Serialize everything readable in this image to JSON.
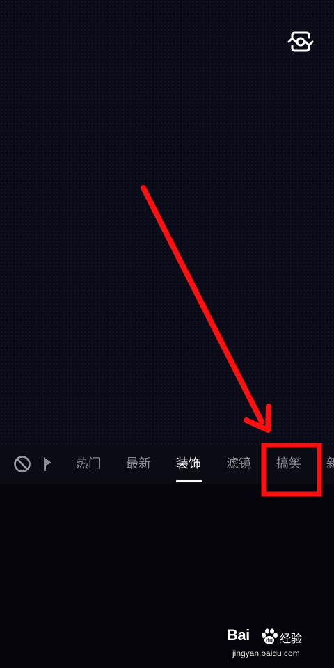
{
  "tabs": [
    {
      "label": "热门",
      "active": false
    },
    {
      "label": "最新",
      "active": false
    },
    {
      "label": "装饰",
      "active": true
    },
    {
      "label": "滤镜",
      "active": false
    },
    {
      "label": "搞笑",
      "active": false
    },
    {
      "label": "新",
      "active": false
    }
  ],
  "icons": {
    "flip_camera": "flip-camera-icon",
    "none": "prohibited-icon",
    "shape": "flag-shape-icon"
  },
  "annotation": {
    "color": "#ff1010",
    "highlighted_tab": "搞笑"
  },
  "watermark": {
    "logo": "Bai",
    "product": "经验",
    "url": "jingyan.baidu.com"
  },
  "colors": {
    "background": "#05050c",
    "tab_active": "#ffffff",
    "tab_inactive": "#8a8a92",
    "annotation_red": "#ff1010"
  }
}
